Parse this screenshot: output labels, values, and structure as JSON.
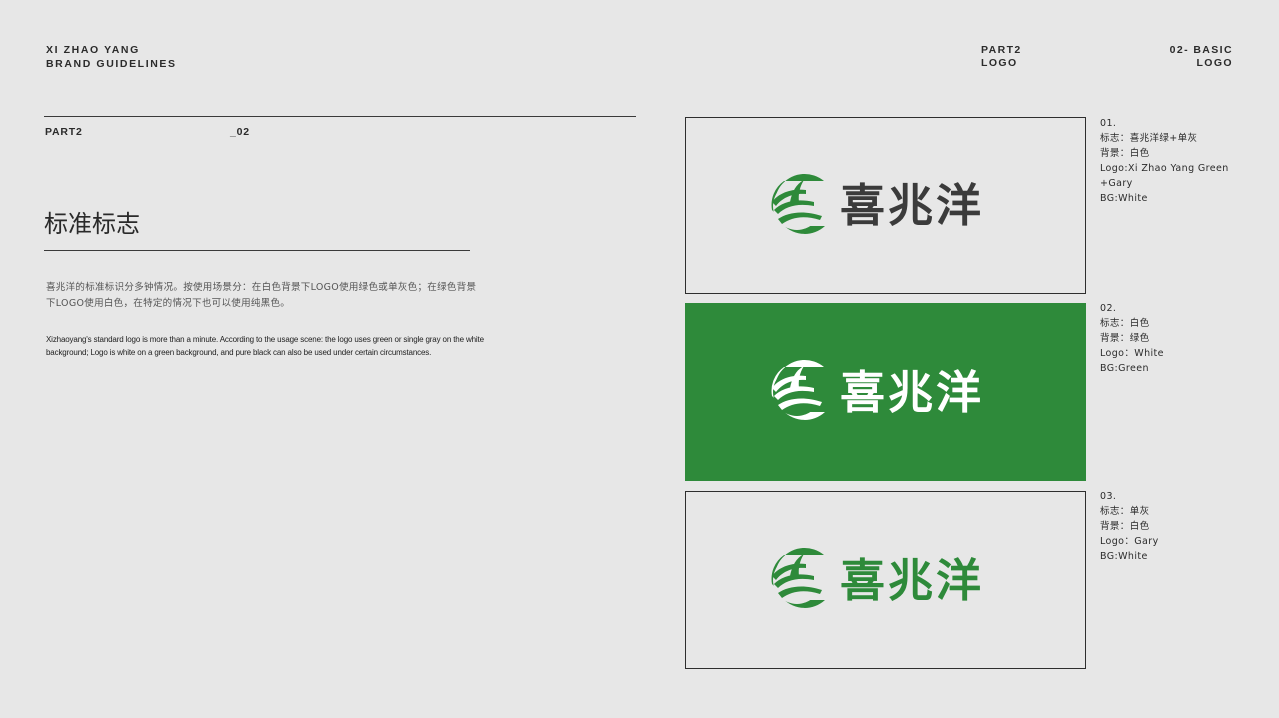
{
  "header": {
    "brand_line1": "XI ZHAO YANG",
    "brand_line2": "BRAND GUIDELINES",
    "part_line1": "PART2",
    "part_line2": "LOGO",
    "section_line1": "02- BASIC",
    "section_line2": "LOGO"
  },
  "left": {
    "part": "PART2",
    "number": "_02",
    "title": "标准标志",
    "desc_cn": "喜兆洋的标准标识分多钟情况。按使用场景分：在白色背景下LOGO使用绿色或单灰色；在绿色背景下LOGO使用白色，在特定的情况下也可以使用纯黑色。",
    "desc_en": "Xizhaoyang's standard logo is more than a minute. According to the usage scene: the logo uses green or single gray on the white background; Logo is white on a green background, and pure black can also be used under certain circumstances."
  },
  "colors": {
    "green": "#2e8a3a",
    "gray": "#3b3b3b",
    "white": "#ffffff",
    "background": "#e7e7e7"
  },
  "panels": [
    {
      "logo_text": "喜兆洋",
      "notes": [
        "01.",
        "标志：喜兆洋绿+单灰",
        "背景：白色",
        "Logo:Xi Zhao Yang Green",
        "+Gary",
        "BG:White"
      ]
    },
    {
      "logo_text": "喜兆洋",
      "notes": [
        "02.",
        "标志：白色",
        "背景：绿色",
        "Logo：White",
        "BG:Green"
      ]
    },
    {
      "logo_text": "喜兆洋",
      "notes": [
        "03.",
        "标志：单灰",
        "背景：白色",
        "Logo：Gary",
        "BG:White"
      ]
    }
  ]
}
